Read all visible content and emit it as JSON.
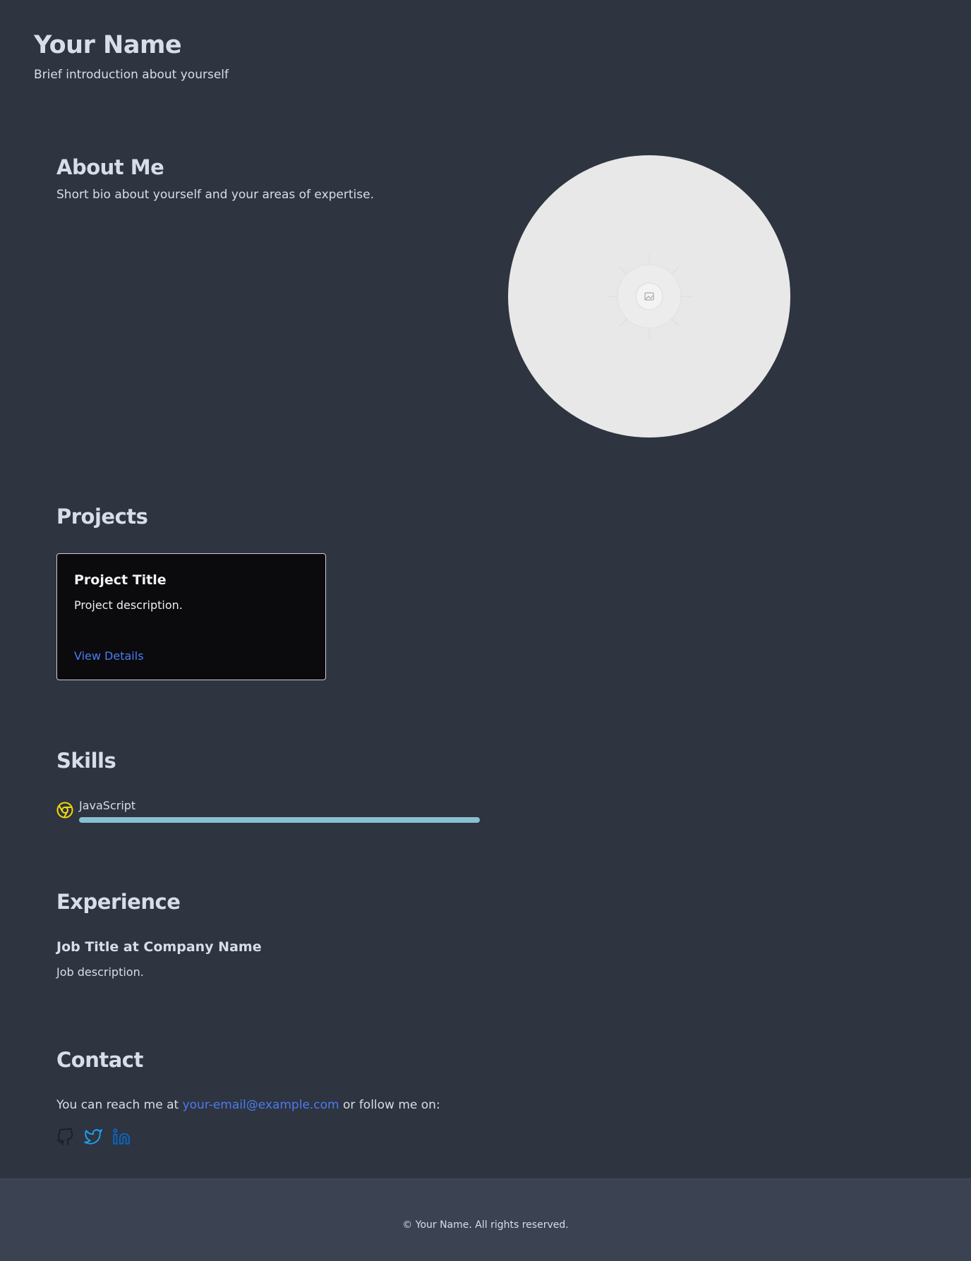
{
  "header": {
    "name": "Your Name",
    "intro": "Brief introduction about yourself"
  },
  "about": {
    "title": "About Me",
    "bio": "Short bio about yourself and your areas of expertise.",
    "portrait_icon": "image-placeholder-icon"
  },
  "projects": {
    "title": "Projects",
    "items": [
      {
        "title": "Project Title",
        "description": "Project description.",
        "link_label": "View Details"
      }
    ]
  },
  "skills": {
    "title": "Skills",
    "items": [
      {
        "name": "JavaScript",
        "icon": "chrome-icon",
        "level_percent": 100
      }
    ]
  },
  "experience": {
    "title": "Experience",
    "items": [
      {
        "title": "Job Title at Company Name",
        "description": "Job description."
      }
    ]
  },
  "contact": {
    "title": "Contact",
    "text_before": "You can reach me at ",
    "email": "your-email@example.com",
    "text_after": " or follow me on:",
    "socials": [
      {
        "icon": "github-icon",
        "color": "#1b1f23"
      },
      {
        "icon": "twitter-icon",
        "color": "#1da1f2"
      },
      {
        "icon": "linkedin-icon",
        "color": "#0a66c2"
      }
    ]
  },
  "footer": {
    "text": "© Your Name. All rights reserved."
  },
  "colors": {
    "background": "#2e3440",
    "footer_background": "#3b4252",
    "text": "#d8dee9",
    "link": "#4c7cf0",
    "skill_bar": "#88c0d0",
    "card_background": "#0b0b0e",
    "skill_icon": "#f5d90a"
  }
}
